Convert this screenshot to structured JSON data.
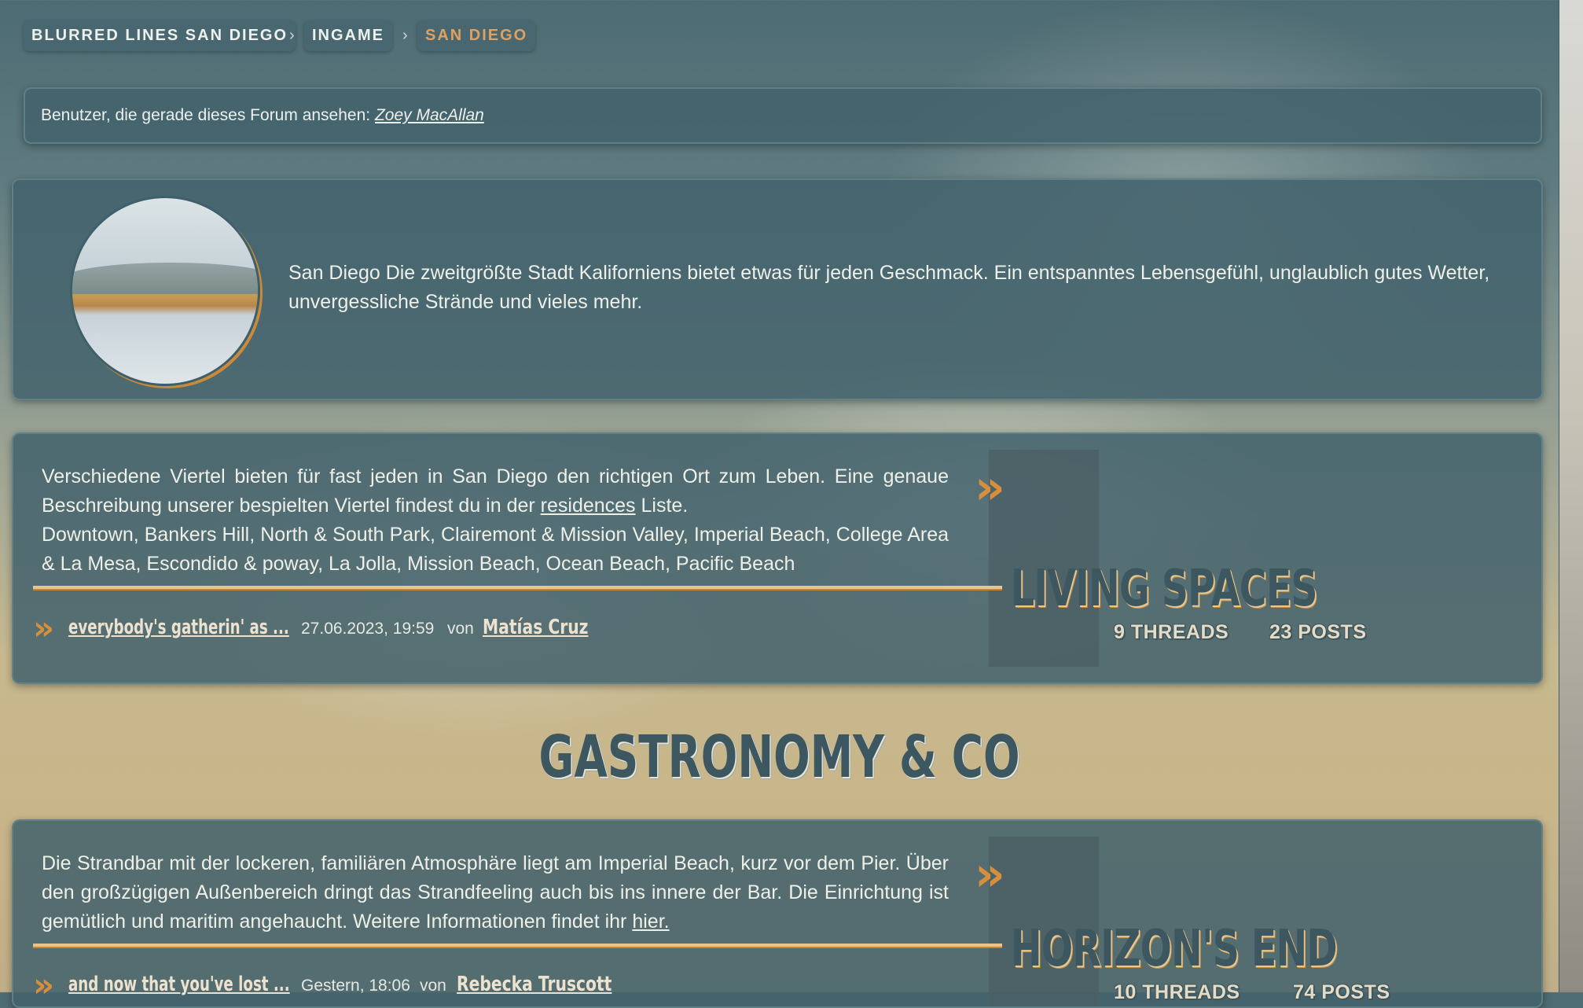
{
  "breadcrumb": {
    "items": [
      "BLURRED LINES SAN DIEGO",
      "INGAME",
      "SAN DIEGO"
    ],
    "separator": "›"
  },
  "online": {
    "label": "Benutzer, die gerade dieses Forum ansehen:",
    "user": "Zoey MacAllan"
  },
  "intro": {
    "avatar_alt": "beach-photo",
    "text": "San Diego Die zweitgrößte Stadt Kaliforniens bietet etwas für jeden Geschmack. Ein entspanntes Lebensgefühl, unglaublich gutes Wetter, unvergessliche Strände und vieles mehr."
  },
  "forums": [
    {
      "desc_before": "Verschiedene Viertel bieten für fast jeden in San Diego den richtigen Ort zum Leben. Eine genaue Beschreibung unserer bespielten Viertel findest du in der ",
      "desc_link": "residences",
      "desc_after": " Liste.",
      "desc_line2": "Downtown, Bankers Hill, North & South Park, Clairemont & Mission Valley, Imperial Beach, College Area & La Mesa, Escondido & poway, La Jolla, Mission Beach, Ocean Beach, Pacific Beach",
      "last_title": "everybody's gatherin' as ...",
      "last_date": "27.06.2023, 19:59",
      "last_by": "von",
      "last_author": "Matías Cruz",
      "title": "LIVING SPACES",
      "threads": "9 THREADS",
      "posts": "23 POSTS"
    },
    {
      "desc_before": "Die Strandbar mit der lockeren, familiären Atmosphäre liegt am Imperial Beach, kurz vor dem Pier. Über den großzügigen Außenbereich dringt das Strandfeeling auch bis ins innere der Bar. Die Einrichtung ist gemütlich und maritim angehaucht. Weitere Informationen findet ihr ",
      "desc_link": "hier.",
      "last_title": "and now that you've lost ...",
      "last_date": "Gestern, 18:06",
      "last_by": "von",
      "last_author": "Rebecka Truscott",
      "title": "HORIZON'S END",
      "threads": "10 THREADS",
      "posts": "74 POSTS"
    }
  ],
  "category_title": "GASTRONOMY & CO",
  "icons": {
    "chevron": "double-chevron-right-icon"
  },
  "colors": {
    "accent": "#d68f3c",
    "panel": "#42626c",
    "title": "#3d5760"
  }
}
